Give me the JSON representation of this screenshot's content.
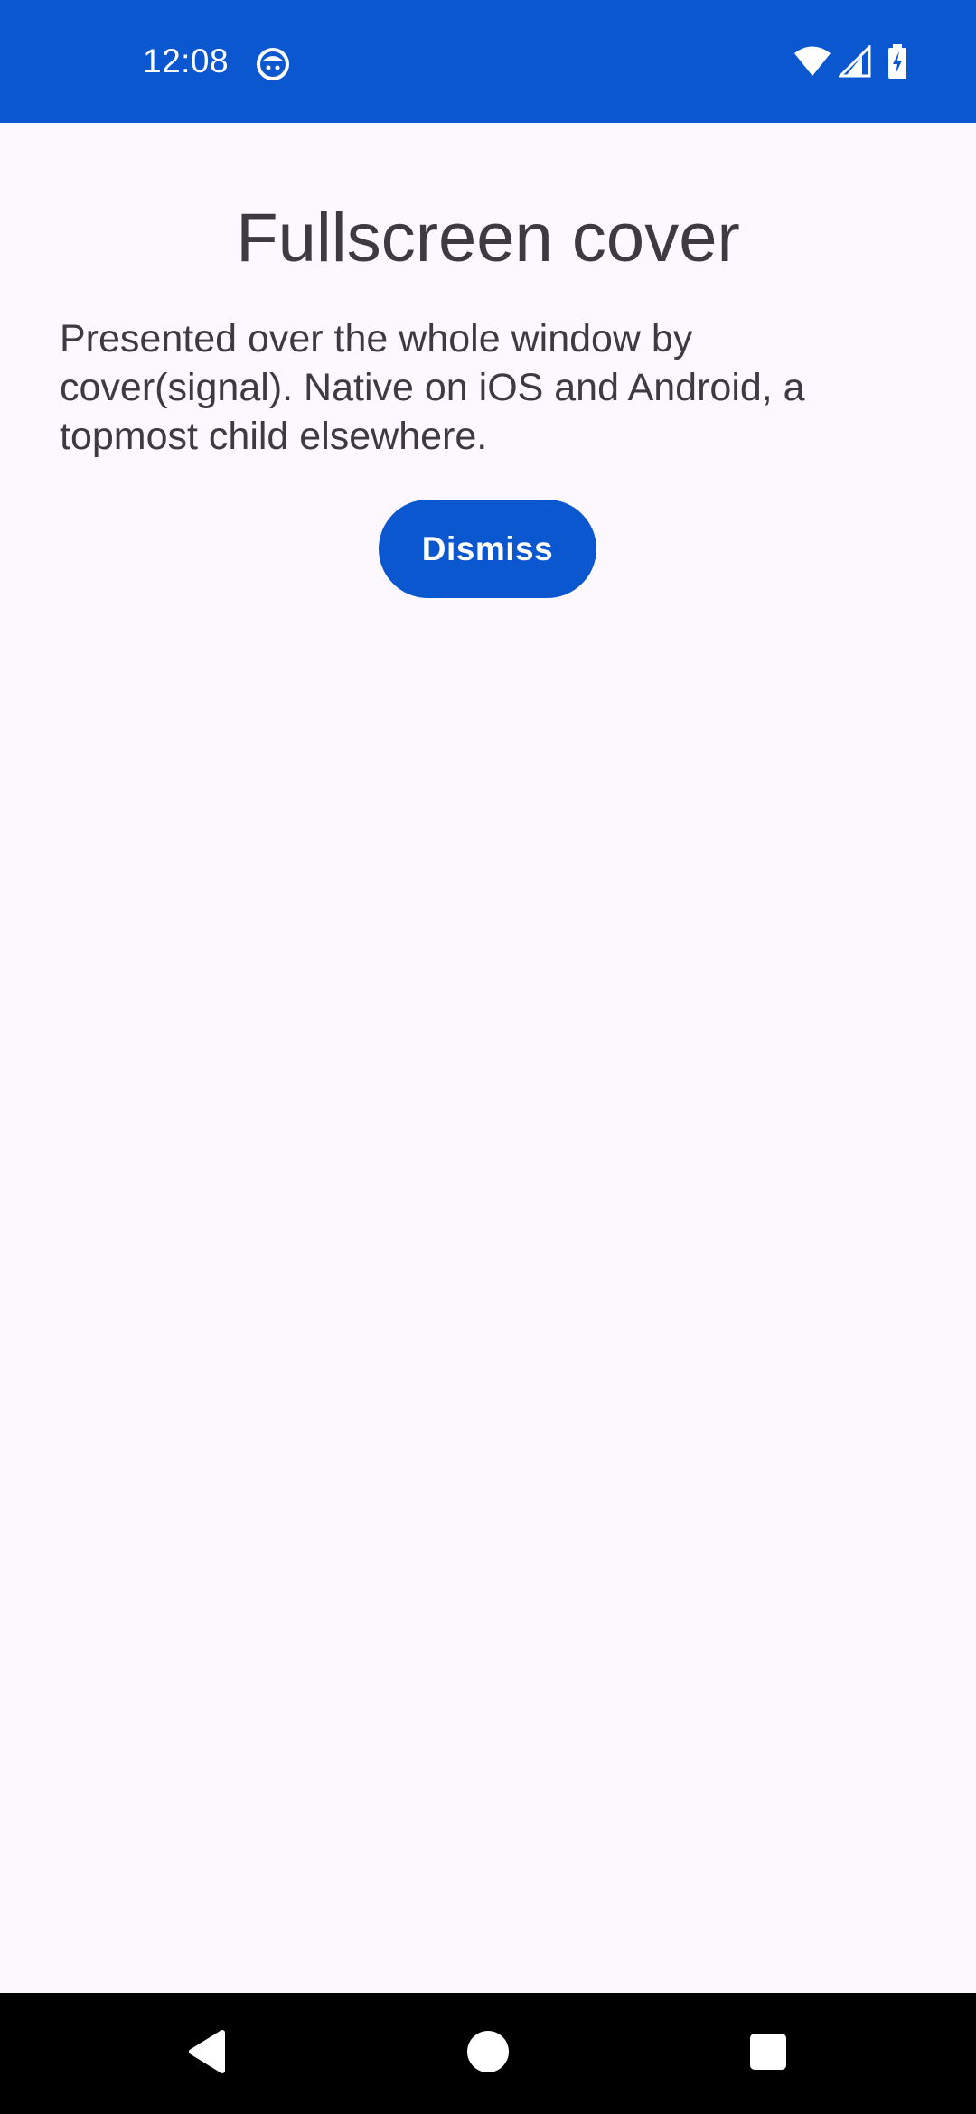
{
  "status_bar": {
    "time": "12:08",
    "background_color": "#0B57CF",
    "icons": [
      "app-notification-icon",
      "wifi-icon",
      "cellular-signal-icon",
      "battery-charging-icon"
    ]
  },
  "cover": {
    "title": "Fullscreen cover",
    "description": "Presented over the whole window by cover(signal). Native on iOS and Android, a topmost child elsewhere.",
    "dismiss_label": "Dismiss",
    "accent_color": "#0B57CF",
    "background_color": "#FDF8FD"
  },
  "nav_bar": {
    "buttons": [
      "back-icon",
      "home-icon",
      "recents-icon"
    ]
  }
}
